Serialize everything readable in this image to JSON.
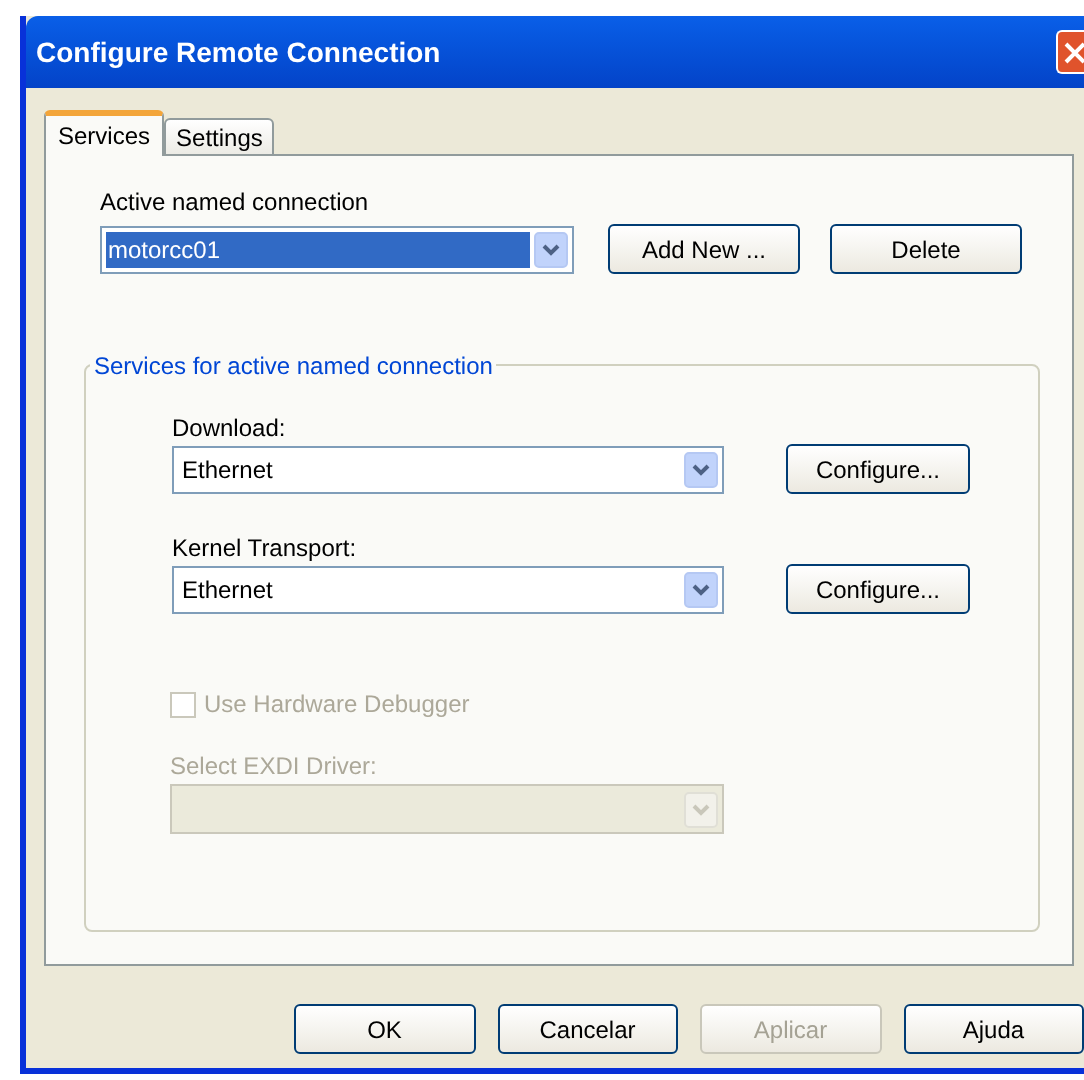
{
  "window": {
    "title": "Configure Remote Connection"
  },
  "tabs": [
    {
      "label": "Services",
      "selected": true
    },
    {
      "label": "Settings",
      "selected": false
    }
  ],
  "connection": {
    "label": "Active named connection",
    "value": "motorcc01",
    "highlighted": true,
    "buttons": [
      {
        "label": "Add New ...",
        "disabled": false
      },
      {
        "label": "Delete",
        "disabled": false
      }
    ]
  },
  "services_group": {
    "title": "Services for active named connection",
    "services": [
      {
        "label": "Download:",
        "value": "Ethernet",
        "button": "Configure..."
      },
      {
        "label": "Kernel Transport:",
        "value": "Ethernet",
        "button": "Configure..."
      }
    ],
    "hardware_debugger": {
      "label": "Use Hardware Debugger",
      "checked": false,
      "disabled": true
    },
    "exdi_driver": {
      "label": "Select EXDI Driver:",
      "disabled": true
    }
  },
  "buttons": [
    {
      "label": "OK",
      "disabled": false
    },
    {
      "label": "Cancelar",
      "disabled": false
    },
    {
      "label": "Aplicar",
      "disabled": true
    },
    {
      "label": "Ajuda",
      "disabled": false
    }
  ]
}
